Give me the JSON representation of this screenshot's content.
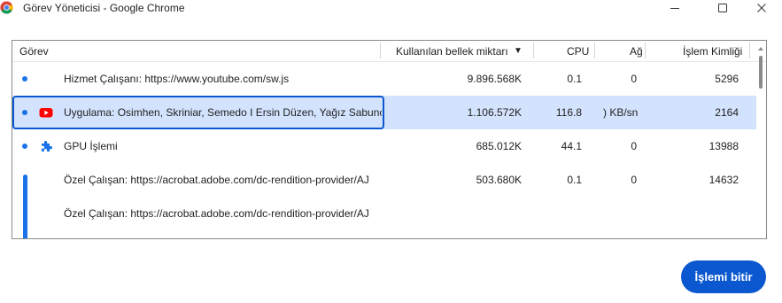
{
  "window": {
    "title": "Görev Yöneticisi - Google Chrome"
  },
  "table": {
    "columns": {
      "task": "Görev",
      "memory": "Kullanılan bellek miktarı",
      "sort_indicator": "▼",
      "cpu": "CPU",
      "network": "Ağ",
      "pid": "İşlem Kimliği"
    },
    "rows": [
      {
        "task": "Hizmet Çalışanı: https://www.youtube.com/sw.js",
        "memory": "9.896.568K",
        "cpu": "0.1",
        "network": "0",
        "pid": "5296",
        "icon": "none"
      },
      {
        "task": "Uygulama: Osimhen, Skriniar, Semedo I Ersin Düzen, Yağız Sabunc",
        "memory": "1.106.572K",
        "cpu": "116.8",
        "network": ") KB/sn",
        "pid": "2164",
        "icon": "youtube-icon"
      },
      {
        "task": "GPU İşlemi",
        "memory": "685.012K",
        "cpu": "44.1",
        "network": "0",
        "pid": "13988",
        "icon": "puzzle-icon"
      },
      {
        "task": "Özel Çalışan: https://acrobat.adobe.com/dc-rendition-provider/AJ",
        "memory": "503.680K",
        "cpu": "0.1",
        "network": "0",
        "pid": "14632",
        "icon": "none"
      },
      {
        "task": "Özel Çalışan: https://acrobat.adobe.com/dc-rendition-provider/AJ",
        "memory": "",
        "cpu": "",
        "network": "",
        "pid": "",
        "icon": "none"
      }
    ]
  },
  "actions": {
    "end_process": "İşlemi bitir"
  },
  "colors": {
    "accent": "#0b57d0",
    "selection": "#d3e3fd",
    "dot": "#1a73e8",
    "youtube": "#ff0000"
  }
}
